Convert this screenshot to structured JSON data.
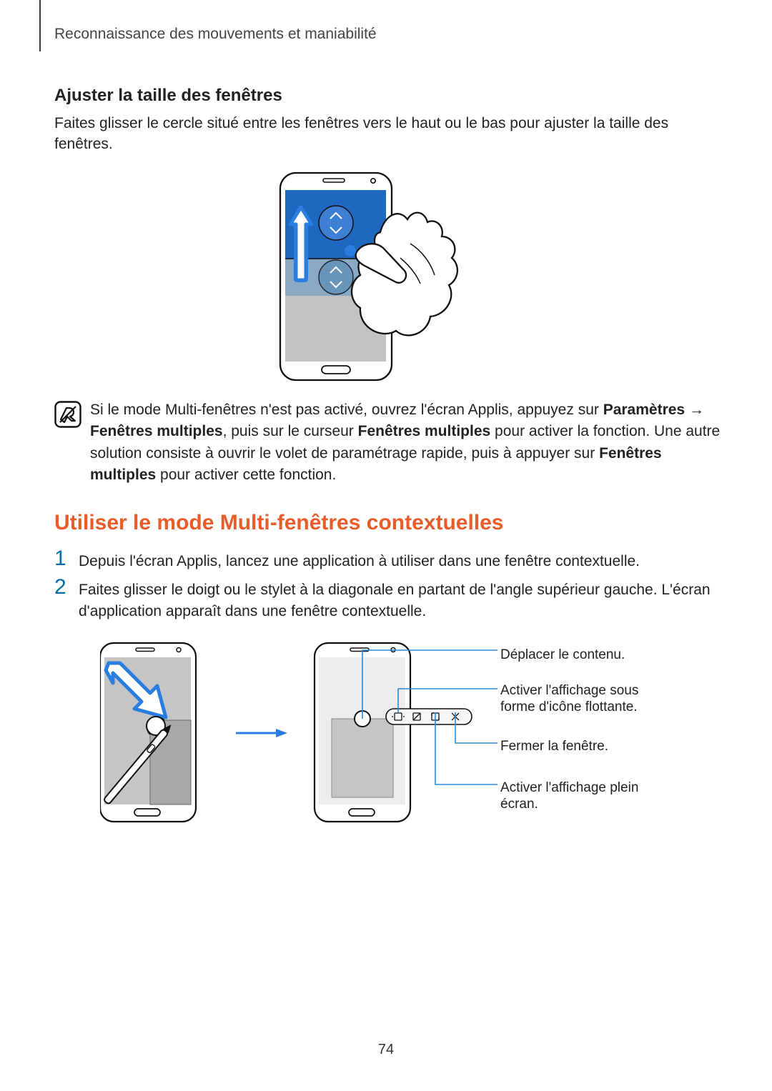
{
  "header": "Reconnaissance des mouvements et maniabilité",
  "subheading1": "Ajuster la taille des fenêtres",
  "para1": "Faites glisser le cercle situé entre les fenêtres vers le haut ou le bas pour ajuster la taille des fenêtres.",
  "note_parts": {
    "p1": "Si le mode Multi-fenêtres n'est pas activé, ouvrez l'écran Applis, appuyez sur ",
    "b1": "Paramètres",
    "p2": " → ",
    "b2": "Fenêtres multiples",
    "p3": ", puis sur le curseur ",
    "b3": "Fenêtres multiples",
    "p4": " pour activer la fonction. Une autre solution consiste à ouvrir le volet de paramétrage rapide, puis à appuyer sur ",
    "b4": "Fenêtres multiples",
    "p5": " pour activer cette fonction."
  },
  "section2": "Utiliser le mode Multi-fenêtres contextuelles",
  "steps": [
    "Depuis l'écran Applis, lancez une application à utiliser dans une fenêtre contextuelle.",
    "Faites glisser le doigt ou le stylet à la diagonale en partant de l'angle supérieur gauche. L'écran d'application apparaît dans une fenêtre contextuelle."
  ],
  "callouts": {
    "move": "Déplacer le contenu.",
    "float": "Activer l'affichage sous forme d'icône flottante.",
    "close": "Fermer la fenêtre.",
    "fullscreen": "Activer l'affichage plein écran."
  },
  "page_number": "74"
}
